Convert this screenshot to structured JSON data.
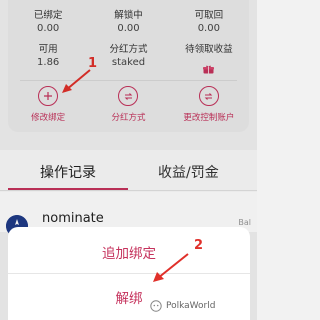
{
  "stats": {
    "bonded": {
      "label": "已绑定",
      "value": "0.00"
    },
    "unlocking": {
      "label": "解锁中",
      "value": "0.00"
    },
    "redeemable": {
      "label": "可取回",
      "value": "0.00"
    },
    "available": {
      "label": "可用",
      "value": "1.86"
    },
    "reward_mode": {
      "label": "分红方式",
      "value": "staked"
    },
    "pending_rewards": {
      "label": "待领取收益",
      "icon": "gift-icon"
    }
  },
  "actions": [
    {
      "label": "修改绑定",
      "icon": "plus-icon"
    },
    {
      "label": "分红方式",
      "icon": "swap-icon"
    },
    {
      "label": "更改控制账户",
      "icon": "swap-icon"
    }
  ],
  "annotations": {
    "one": "1",
    "two": "2"
  },
  "tabs": [
    {
      "label": "操作记录",
      "active": true
    },
    {
      "label": "收益/罚金",
      "active": false
    }
  ],
  "records": [
    {
      "title": "nominate",
      "right": "Bal"
    }
  ],
  "sheet": {
    "add_bond": "追加绑定",
    "unbond": "解绑"
  },
  "watermark": "PolkaWorld",
  "colors": {
    "accent": "#c5325c",
    "annotation": "#e0302a"
  }
}
